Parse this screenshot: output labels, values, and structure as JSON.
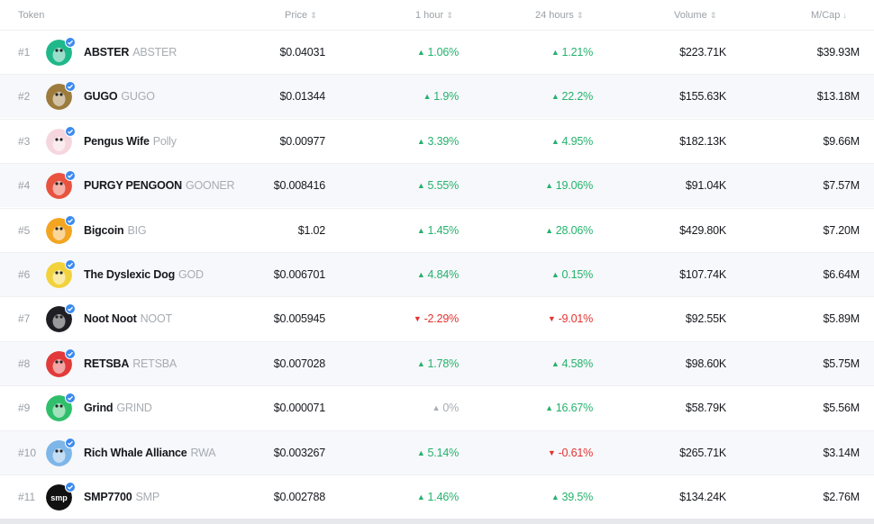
{
  "header": {
    "token": "Token",
    "price": "Price",
    "hour1": "1 hour",
    "hours24": "24 hours",
    "volume": "Volume",
    "mcap": "M/Cap",
    "sort_icon": "⇕",
    "sort_desc_icon": "↓"
  },
  "rows": [
    {
      "rank": "#1",
      "name": "ABSTER",
      "symbol": "ABSTER",
      "price": "$0.04031",
      "h1": "1.06%",
      "h1_dir": "up",
      "h24": "1.21%",
      "h24_dir": "up",
      "volume": "$223.71K",
      "mcap": "$39.93M",
      "avatar_color": "#1fb88a",
      "avatar_icon": "penguin-icon"
    },
    {
      "rank": "#2",
      "name": "GUGO",
      "symbol": "GUGO",
      "price": "$0.01344",
      "h1": "1.9%",
      "h1_dir": "up",
      "h24": "22.2%",
      "h24_dir": "up",
      "volume": "$155.63K",
      "mcap": "$13.18M",
      "avatar_color": "#9c7b3c",
      "avatar_icon": "gugo-icon"
    },
    {
      "rank": "#3",
      "name": "Pengus Wife",
      "symbol": "Polly",
      "price": "$0.00977",
      "h1": "3.39%",
      "h1_dir": "up",
      "h24": "4.95%",
      "h24_dir": "up",
      "volume": "$182.13K",
      "mcap": "$9.66M",
      "avatar_color": "#f6d6de",
      "avatar_icon": "penguin-icon"
    },
    {
      "rank": "#4",
      "name": "PURGY PENGOON",
      "symbol": "GOONER",
      "price": "$0.008416",
      "h1": "5.55%",
      "h1_dir": "up",
      "h24": "19.06%",
      "h24_dir": "up",
      "volume": "$91.04K",
      "mcap": "$7.57M",
      "avatar_color": "#e8533f",
      "avatar_icon": "penguin-icon"
    },
    {
      "rank": "#5",
      "name": "Bigcoin",
      "symbol": "BIG",
      "price": "$1.02",
      "h1": "1.45%",
      "h1_dir": "up",
      "h24": "28.06%",
      "h24_dir": "up",
      "volume": "$429.80K",
      "mcap": "$7.20M",
      "avatar_color": "#f3a521",
      "avatar_icon": "bitcoin-icon"
    },
    {
      "rank": "#6",
      "name": "The Dyslexic Dog",
      "symbol": "GOD",
      "price": "$0.006701",
      "h1": "4.84%",
      "h1_dir": "up",
      "h24": "0.15%",
      "h24_dir": "up",
      "volume": "$107.74K",
      "mcap": "$6.64M",
      "avatar_color": "#f2d23c",
      "avatar_icon": "dog-icon"
    },
    {
      "rank": "#7",
      "name": "Noot Noot",
      "symbol": "NOOT",
      "price": "$0.005945",
      "h1": "-2.29%",
      "h1_dir": "down",
      "h24": "-9.01%",
      "h24_dir": "down",
      "volume": "$92.55K",
      "mcap": "$5.89M",
      "avatar_color": "#1e1e24",
      "avatar_icon": "penguin-icon"
    },
    {
      "rank": "#8",
      "name": "RETSBA",
      "symbol": "RETSBA",
      "price": "$0.007028",
      "h1": "1.78%",
      "h1_dir": "up",
      "h24": "4.58%",
      "h24_dir": "up",
      "volume": "$98.60K",
      "mcap": "$5.75M",
      "avatar_color": "#e23a3a",
      "avatar_icon": "penguin-icon"
    },
    {
      "rank": "#9",
      "name": "Grind",
      "symbol": "GRIND",
      "price": "$0.000071",
      "h1": "0%",
      "h1_dir": "flat",
      "h24": "16.67%",
      "h24_dir": "up",
      "volume": "$58.79K",
      "mcap": "$5.56M",
      "avatar_color": "#2fbf6b",
      "avatar_icon": "grind-icon"
    },
    {
      "rank": "#10",
      "name": "Rich Whale Alliance",
      "symbol": "RWA",
      "price": "$0.003267",
      "h1": "5.14%",
      "h1_dir": "up",
      "h24": "-0.61%",
      "h24_dir": "down",
      "volume": "$265.71K",
      "mcap": "$3.14M",
      "avatar_color": "#7eb6e8",
      "avatar_icon": "whale-icon"
    },
    {
      "rank": "#11",
      "name": "SMP7700",
      "symbol": "SMP",
      "price": "$0.002788",
      "h1": "1.46%",
      "h1_dir": "up",
      "h24": "39.5%",
      "h24_dir": "up",
      "volume": "$134.24K",
      "mcap": "$2.76M",
      "avatar_color": "#111111",
      "avatar_icon": "smp-icon",
      "avatar_text": "smp"
    }
  ]
}
